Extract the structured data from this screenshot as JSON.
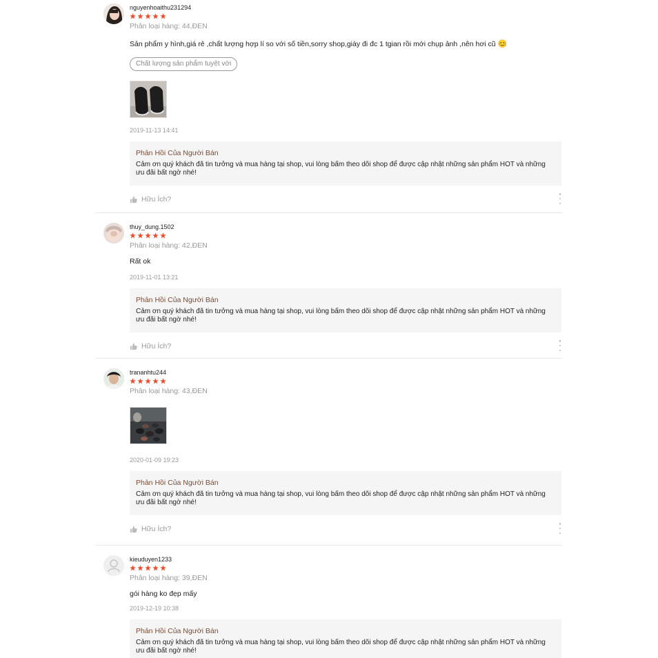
{
  "reviews": [
    {
      "username": "nguyenhoaithu231294",
      "rating": 5,
      "variant": "Phân loại hàng: 44,ĐEN",
      "content": "Sản phẩm y hình,giá rẻ ,chất lượng hợp lí so với số tiền,sorry shop,giày đi đc 1 tgian rồi mới chụp ảnh ,nên hơi cũ",
      "emoji": "😊",
      "tag": "Chất lượng sản phẩm tuyệt vời",
      "date": "2019-11-13 14:41",
      "reply_title": "Phản Hồi Của Người Bán",
      "reply_text": "Cảm ơn quý khách đã tin tưởng và mua hàng tại shop, vui lòng bấm theo dõi shop để được cập nhật những sản phẩm HOT và những ưu đãi bất ngờ nhé!",
      "helpful": "Hữu Ích?"
    },
    {
      "username": "thuy_dung.1502",
      "rating": 5,
      "variant": "Phân loại hàng: 42,ĐEN",
      "content": "Rất ok",
      "date": "2019-11-01 13:21",
      "reply_title": "Phản Hồi Của Người Bán",
      "reply_text": "Cảm ơn quý khách đã tin tưởng và mua hàng tại shop, vui lòng bấm theo dõi shop để được cập nhật những sản phẩm HOT và những ưu đãi bất ngờ nhé!",
      "helpful": "Hữu Ích?"
    },
    {
      "username": "trananhtu244",
      "rating": 5,
      "variant": "Phân loại hàng: 43,ĐEN",
      "date": "2020-01-09 19:23",
      "reply_title": "Phản Hồi Của Người Bán",
      "reply_text": "Cảm ơn quý khách đã tin tưởng và mua hàng tại shop, vui lòng bấm theo dõi shop để được cập nhật những sản phẩm HOT và những ưu đãi bất ngờ nhé!",
      "helpful": "Hữu Ích?"
    },
    {
      "username": "kieuduyen1233",
      "rating": 5,
      "variant": "Phân loại hàng: 39,ĐEN",
      "content": "gói hàng ko đẹp mấy",
      "date": "2019-12-19 10:38",
      "reply_title": "Phản Hồi Của Người Bán",
      "reply_text": "Cảm ơn quý khách đã tin tưởng và mua hàng tại shop, vui lòng bấm theo dõi shop để được cập nhật những sản phẩm HOT và những ưu đãi bất ngờ nhé!"
    }
  ],
  "colors": {
    "star": "#ee4d2d",
    "reply_title": "#7a4b35",
    "reply_bg": "#f5f5f5",
    "muted": "#999999"
  }
}
